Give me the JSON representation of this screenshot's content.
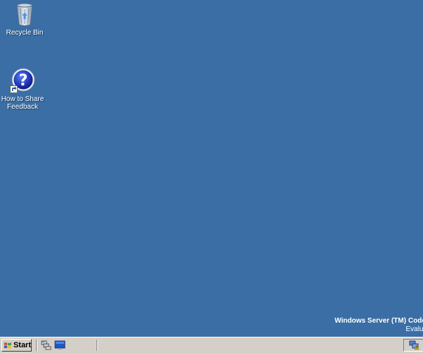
{
  "desktop": {
    "background_color": "#3a6ea5",
    "icons": [
      {
        "label": "Recycle Bin",
        "icon": "recycle-bin-icon"
      },
      {
        "label": "How to Share\nFeedback",
        "icon": "help-question-icon",
        "shortcut": true
      }
    ]
  },
  "watermark": {
    "line1": "Windows Server (TM) Code Name",
    "line2": "Evaluation c"
  },
  "taskbar": {
    "start_label": "Start",
    "quick_launch": [
      {
        "icon": "server-manager-icon"
      },
      {
        "icon": "show-desktop-icon"
      }
    ],
    "tray": [
      {
        "icon": "network-warning-icon"
      }
    ]
  }
}
